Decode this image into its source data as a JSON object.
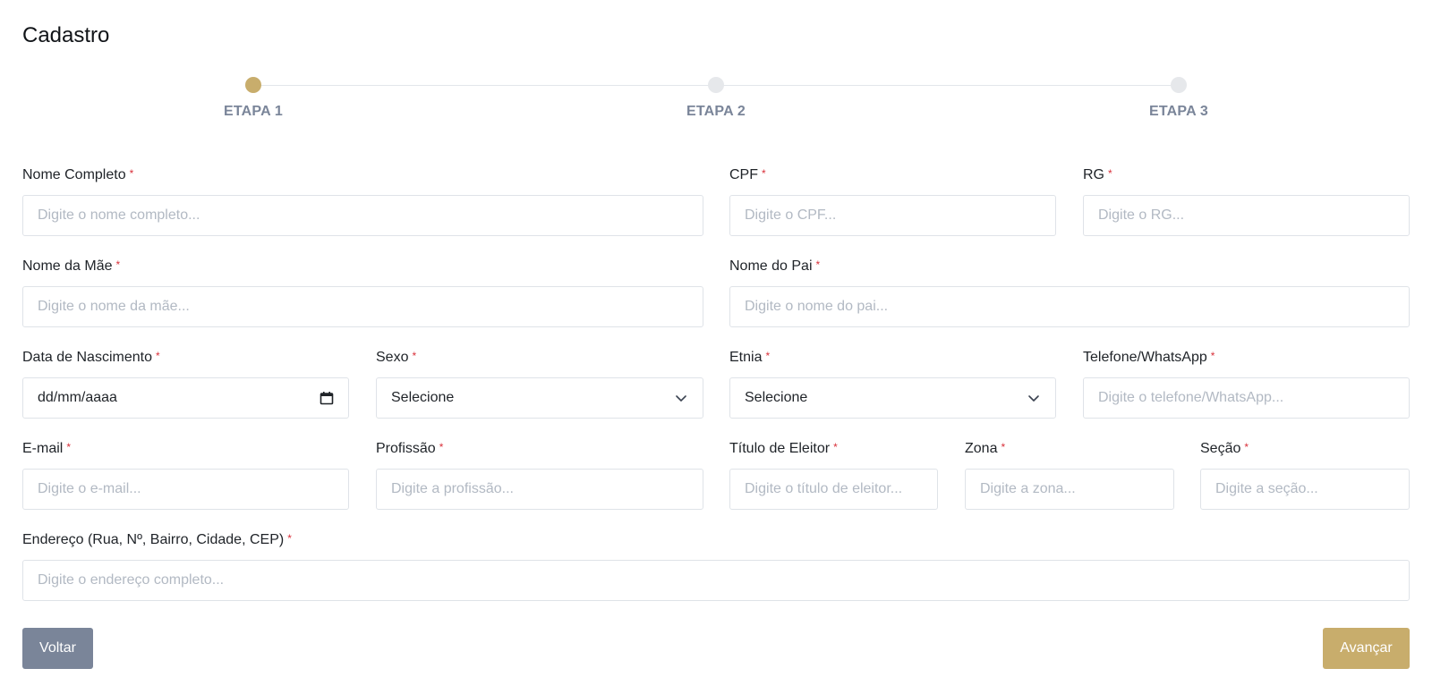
{
  "page": {
    "title": "Cadastro"
  },
  "stepper": {
    "steps": [
      {
        "label": "ETAPA 1",
        "active": true
      },
      {
        "label": "ETAPA 2",
        "active": false
      },
      {
        "label": "ETAPA 3",
        "active": false
      }
    ],
    "active_color": "#c8ad6c",
    "inactive_color": "#e6e8eb"
  },
  "required_marker": "*",
  "fields": {
    "nome_completo": {
      "label": "Nome Completo",
      "placeholder": "Digite o nome completo..."
    },
    "cpf": {
      "label": "CPF",
      "placeholder": "Digite o CPF..."
    },
    "rg": {
      "label": "RG",
      "placeholder": "Digite o RG..."
    },
    "nome_mae": {
      "label": "Nome da Mãe",
      "placeholder": "Digite o nome da mãe..."
    },
    "nome_pai": {
      "label": "Nome do Pai",
      "placeholder": "Digite o nome do pai..."
    },
    "data_nascimento": {
      "label": "Data de Nascimento",
      "value": "dd/mm/aaaa"
    },
    "sexo": {
      "label": "Sexo",
      "value": "Selecione"
    },
    "etnia": {
      "label": "Etnia",
      "value": "Selecione"
    },
    "telefone": {
      "label": "Telefone/WhatsApp",
      "placeholder": "Digite o telefone/WhatsApp..."
    },
    "email": {
      "label": "E-mail",
      "placeholder": "Digite o e-mail..."
    },
    "profissao": {
      "label": "Profissão",
      "placeholder": "Digite a profissão..."
    },
    "titulo_eleitor": {
      "label": "Título de Eleitor",
      "placeholder": "Digite o título de eleitor..."
    },
    "zona": {
      "label": "Zona",
      "placeholder": "Digite a zona..."
    },
    "secao": {
      "label": "Seção",
      "placeholder": "Digite a seção..."
    },
    "endereco": {
      "label": "Endereço (Rua, Nº, Bairro, Cidade, CEP)",
      "placeholder": "Digite o endereço completo..."
    }
  },
  "buttons": {
    "back": "Voltar",
    "next": "Avançar"
  },
  "icons": {
    "calendar": "calendar-icon",
    "chevron": "chevron-down-icon"
  }
}
